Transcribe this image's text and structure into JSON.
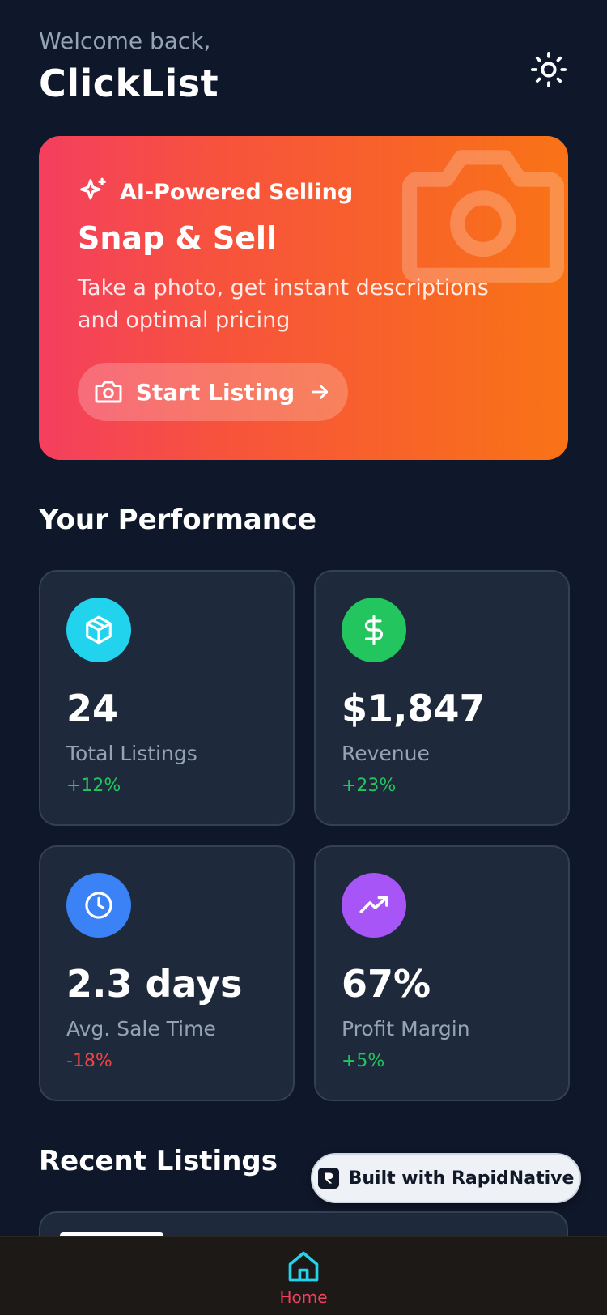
{
  "header": {
    "welcome": "Welcome back,",
    "title": "ClickList",
    "theme_icon": "sun-icon"
  },
  "hero": {
    "badge_icon": "sparkles-icon",
    "badge_label": "AI-Powered Selling",
    "title": "Snap & Sell",
    "description": "Take a photo, get instant descriptions and optimal pricing",
    "button_label": "Start Listing",
    "button_icon": "camera-icon",
    "button_arrow_icon": "arrow-right-icon",
    "gradient_start": "#f43f5e",
    "gradient_end": "#f97316"
  },
  "performance": {
    "title": "Your Performance",
    "stats": [
      {
        "icon": "package-icon",
        "icon_color": "#22d3ee",
        "value": "24",
        "label": "Total Listings",
        "change": "+12%",
        "trend": "positive"
      },
      {
        "icon": "dollar-icon",
        "icon_color": "#22c55e",
        "value": "$1,847",
        "label": "Revenue",
        "change": "+23%",
        "trend": "positive"
      },
      {
        "icon": "clock-icon",
        "icon_color": "#3b82f6",
        "value": "2.3 days",
        "label": "Avg. Sale Time",
        "change": "-18%",
        "trend": "negative"
      },
      {
        "icon": "trending-up-icon",
        "icon_color": "#a855f7",
        "value": "67%",
        "label": "Profit Margin",
        "change": "+5%",
        "trend": "positive"
      }
    ]
  },
  "recent": {
    "title": "Recent Listings"
  },
  "badge": {
    "label": "Built with RapidNative"
  },
  "nav": {
    "home_label": "Home",
    "active_color": "#f43f5e",
    "icon_color": "#22d3ee"
  }
}
